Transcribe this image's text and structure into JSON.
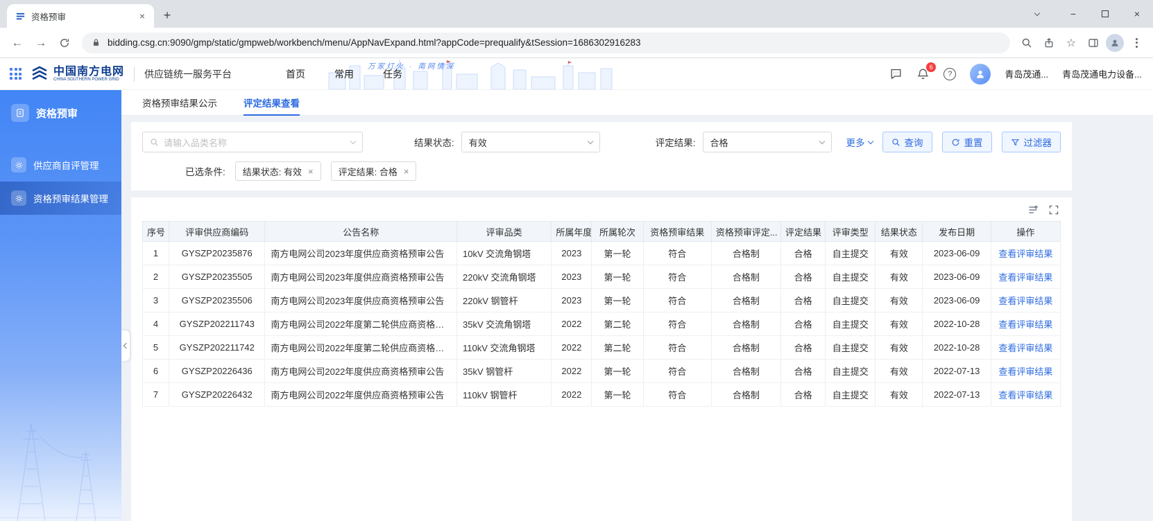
{
  "browser": {
    "tab_title": "资格预审",
    "url": "bidding.csg.cn:9090/gmp/static/gmpweb/workbench/menu/AppNavExpand.html?appCode=prequalify&tSession=1686302916283"
  },
  "header": {
    "logo_title": "中国南方电网",
    "logo_subtitle": "CHINA SOUTHERN POWER GRID",
    "platform_name": "供应链统一服务平台",
    "nav": [
      {
        "label": "首页"
      },
      {
        "label": "常用"
      },
      {
        "label": "任务"
      }
    ],
    "slogan": "万家灯火 · 南网情深",
    "notification_count": "6",
    "user_name": "青岛茂通...",
    "company_name": "青岛茂通电力设备..."
  },
  "sidebar": {
    "app_title": "资格预审",
    "items": [
      {
        "label": "供应商自评管理"
      },
      {
        "label": "资格预审结果管理"
      }
    ]
  },
  "content": {
    "tabs": [
      {
        "label": "资格预审结果公示"
      },
      {
        "label": "评定结果查看"
      }
    ]
  },
  "filters": {
    "search_placeholder": "请输入品类名称",
    "result_status_label": "结果状态:",
    "result_status_value": "有效",
    "eval_result_label": "评定结果:",
    "eval_result_value": "合格",
    "more_label": "更多",
    "query_label": "查询",
    "reset_label": "重置",
    "filter_label": "过滤器",
    "selected_label": "已选条件:",
    "selected_tags": [
      "结果状态: 有效",
      "评定结果: 合格"
    ]
  },
  "table": {
    "headers": [
      "序号",
      "评审供应商编码",
      "公告名称",
      "评审品类",
      "所属年度",
      "所属轮次",
      "资格预审结果",
      "资格预审评定...",
      "评定结果",
      "评审类型",
      "结果状态",
      "发布日期",
      "操作"
    ],
    "action_label": "查看评审结果",
    "rows": [
      [
        "1",
        "GYSZP20235876",
        "南方电网公司2023年度供应商资格预审公告",
        "10kV 交流角钢塔",
        "2023",
        "第一轮",
        "符合",
        "合格制",
        "合格",
        "自主提交",
        "有效",
        "2023-06-09"
      ],
      [
        "2",
        "GYSZP20235505",
        "南方电网公司2023年度供应商资格预审公告",
        "220kV 交流角钢塔",
        "2023",
        "第一轮",
        "符合",
        "合格制",
        "合格",
        "自主提交",
        "有效",
        "2023-06-09"
      ],
      [
        "3",
        "GYSZP20235506",
        "南方电网公司2023年度供应商资格预审公告",
        "220kV 钢管杆",
        "2023",
        "第一轮",
        "符合",
        "合格制",
        "合格",
        "自主提交",
        "有效",
        "2023-06-09"
      ],
      [
        "4",
        "GYSZP202211743",
        "南方电网公司2022年度第二轮供应商资格预审公...",
        "35kV 交流角钢塔",
        "2022",
        "第二轮",
        "符合",
        "合格制",
        "合格",
        "自主提交",
        "有效",
        "2022-10-28"
      ],
      [
        "5",
        "GYSZP202211742",
        "南方电网公司2022年度第二轮供应商资格预审公...",
        "110kV 交流角钢塔",
        "2022",
        "第二轮",
        "符合",
        "合格制",
        "合格",
        "自主提交",
        "有效",
        "2022-10-28"
      ],
      [
        "6",
        "GYSZP20226436",
        "南方电网公司2022年度供应商资格预审公告",
        "35kV 钢管杆",
        "2022",
        "第一轮",
        "符合",
        "合格制",
        "合格",
        "自主提交",
        "有效",
        "2022-07-13"
      ],
      [
        "7",
        "GYSZP20226432",
        "南方电网公司2022年度供应商资格预审公告",
        "110kV 钢管杆",
        "2022",
        "第一轮",
        "符合",
        "合格制",
        "合格",
        "自主提交",
        "有效",
        "2022-07-13"
      ]
    ]
  }
}
